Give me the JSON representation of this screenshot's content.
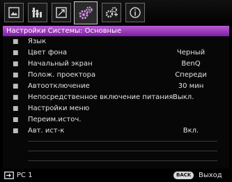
{
  "tabs": [
    {
      "icon": "display-icon",
      "active": false
    },
    {
      "icon": "picture-adjust-icon",
      "active": false
    },
    {
      "icon": "image-resize-icon",
      "active": false
    },
    {
      "icon": "settings-gears-icon",
      "active": true
    },
    {
      "icon": "advanced-settings-icon",
      "active": false
    },
    {
      "icon": "info-icon",
      "active": false
    }
  ],
  "menu": {
    "title": "Настройки Системы: Основные",
    "items": [
      {
        "label": "Язык",
        "value": ""
      },
      {
        "label": "Цвет фона",
        "value": "Черный"
      },
      {
        "label": "Начальный экран",
        "value": "BenQ"
      },
      {
        "label": "Полож. проектора",
        "value": "Спереди"
      },
      {
        "label": "Автоотключение",
        "value": "30 мин"
      },
      {
        "label": "Непосредственное включение питания",
        "value": "Выкл."
      },
      {
        "label": "Настройки меню",
        "value": ""
      },
      {
        "label": "Переим.источ.",
        "value": ""
      },
      {
        "label": "Авт. ист-к",
        "value": "Вкл."
      }
    ]
  },
  "bottom": {
    "source": "PC 1",
    "back_key": "BACK",
    "exit_label": "Выход"
  },
  "colors": {
    "title_bar": "#9a3ab8",
    "background": "#000000",
    "text": "#e2e2e2"
  }
}
